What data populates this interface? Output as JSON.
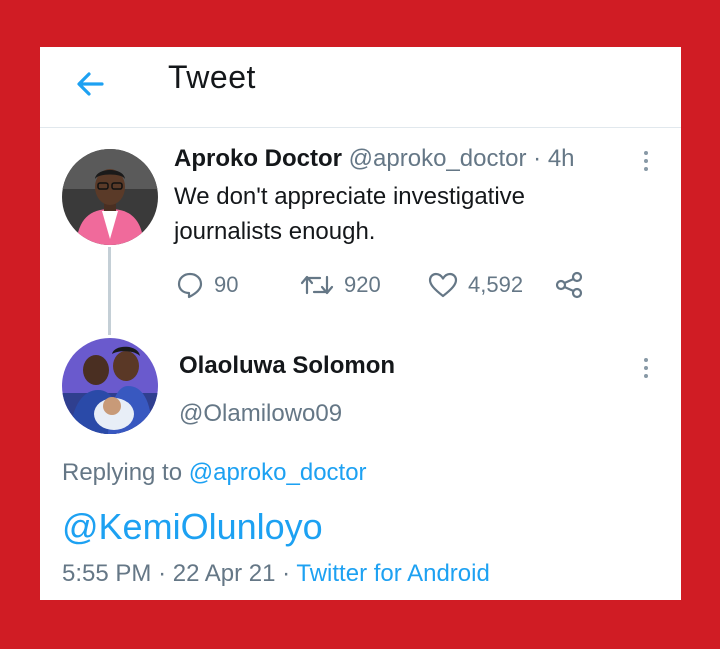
{
  "header": {
    "title": "Tweet"
  },
  "tweet": {
    "author_name": "Aproko Doctor",
    "author_handle": "@aproko_doctor",
    "separator": "·",
    "age": "4h",
    "text": "We don't appreciate investigative journalists enough.",
    "stats": {
      "replies": "90",
      "retweets": "920",
      "likes": "4,592"
    }
  },
  "reply": {
    "author_name": "Olaoluwa Solomon",
    "author_handle": "@Olamilowo09",
    "replying_prefix": "Replying to",
    "replying_to": "@aproko_doctor",
    "text": "@KemiOlunloyo",
    "time": "5:55 PM",
    "date": "22 Apr 21",
    "separator": "·",
    "source": "Twitter for Android"
  },
  "icons": {
    "back": "arrow-left-icon",
    "more": "more-vertical-icon",
    "reply": "reply-bubble-icon",
    "retweet": "retweet-icon",
    "like": "heart-icon",
    "share": "share-icon"
  },
  "colors": {
    "frame": "#D01C24",
    "accent": "#1DA1F2",
    "text_primary": "#14171A",
    "text_secondary": "#657786"
  }
}
